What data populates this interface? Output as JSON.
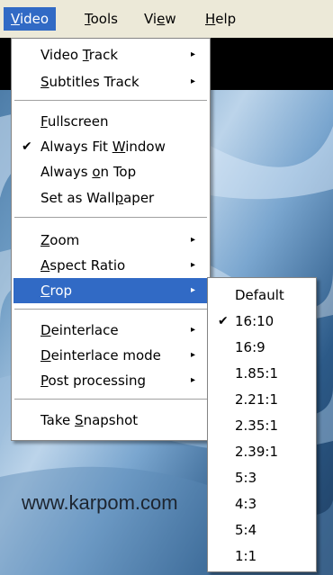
{
  "menubar": {
    "items": [
      {
        "pre": "",
        "u": "V",
        "post": "ideo"
      },
      {
        "pre": "",
        "u": "T",
        "post": "ools"
      },
      {
        "pre": "Vi",
        "u": "e",
        "post": "w"
      },
      {
        "pre": "",
        "u": "H",
        "post": "elp"
      }
    ]
  },
  "video_menu": {
    "items": [
      {
        "pre": "Video ",
        "u": "T",
        "post": "rack",
        "arrow": "▸"
      },
      {
        "pre": "",
        "u": "S",
        "post": "ubtitles Track",
        "arrow": "▸"
      },
      {
        "pre": "",
        "u": "F",
        "post": "ullscreen"
      },
      {
        "pre": "Always Fit ",
        "u": "W",
        "post": "indow",
        "check": "✔"
      },
      {
        "pre": "Always ",
        "u": "o",
        "post": "n Top"
      },
      {
        "pre": "Set as Wall",
        "u": "p",
        "post": "aper"
      },
      {
        "pre": "",
        "u": "Z",
        "post": "oom",
        "arrow": "▸"
      },
      {
        "pre": "",
        "u": "A",
        "post": "spect Ratio",
        "arrow": "▸"
      },
      {
        "pre": "",
        "u": "C",
        "post": "rop",
        "arrow": "▸"
      },
      {
        "pre": "",
        "u": "D",
        "post": "einterlace",
        "arrow": "▸"
      },
      {
        "pre": "",
        "u": "D",
        "post": "einterlace mode",
        "arrow": "▸"
      },
      {
        "pre": "",
        "u": "P",
        "post": "ost processing",
        "arrow": "▸"
      },
      {
        "pre": "Take ",
        "u": "S",
        "post": "napshot"
      }
    ]
  },
  "crop_menu": {
    "items": [
      {
        "label": "Default"
      },
      {
        "label": "16:10",
        "check": "✔"
      },
      {
        "label": "16:9"
      },
      {
        "label": "1.85:1"
      },
      {
        "label": "2.21:1"
      },
      {
        "label": "2.35:1"
      },
      {
        "label": "2.39:1"
      },
      {
        "label": "5:3"
      },
      {
        "label": "4:3"
      },
      {
        "label": "5:4"
      },
      {
        "label": "1:1"
      }
    ]
  },
  "watermark": "www.karpom.com",
  "colors": {
    "highlight": "#316ac5",
    "menubar_bg": "#ece9d8"
  }
}
